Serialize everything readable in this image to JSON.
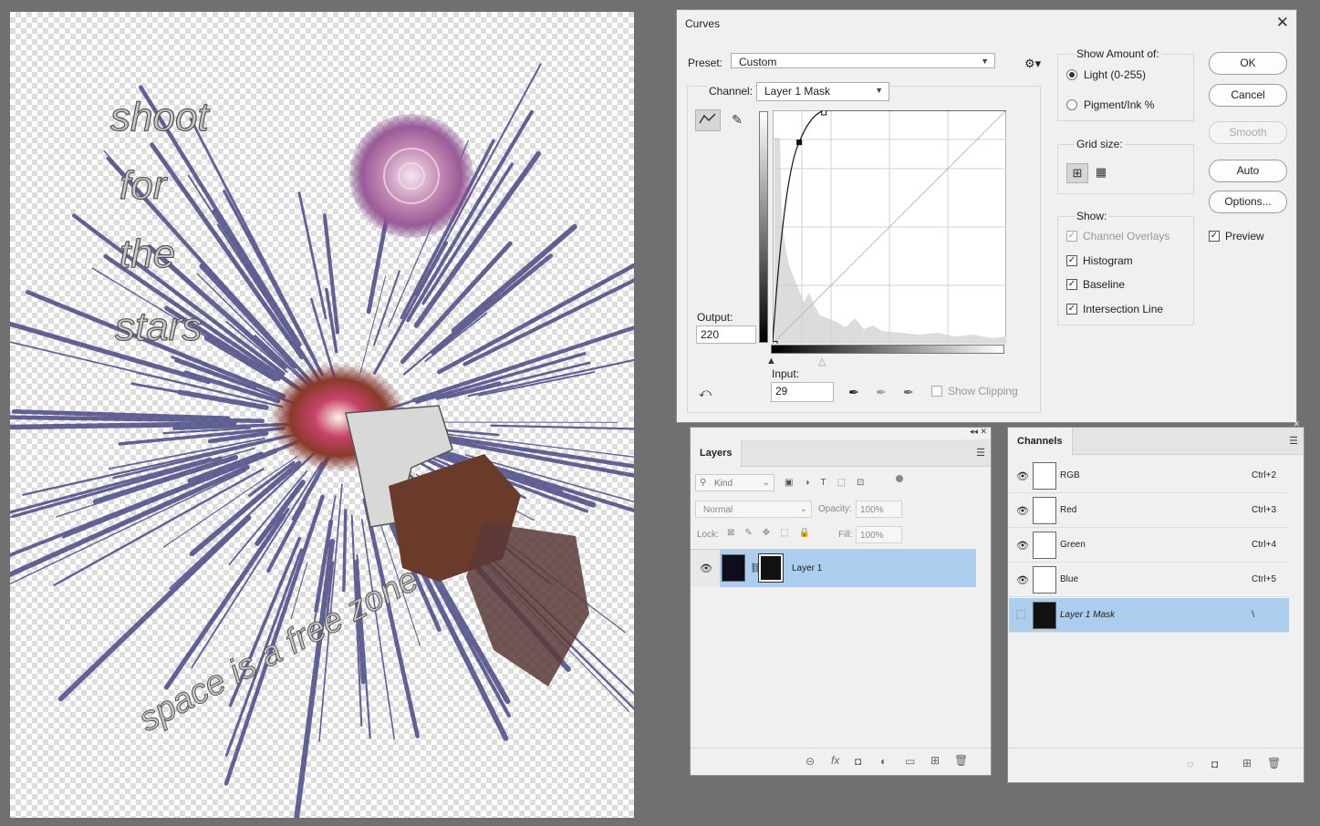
{
  "artwork": {
    "lines": [
      "shoot",
      "for",
      "the",
      "stars"
    ],
    "bottom_text": "space is a free zone"
  },
  "curves": {
    "title": "Curves",
    "preset_label": "Preset:",
    "preset_value": "Custom",
    "channel_label": "Channel:",
    "channel_value": "Layer 1 Mask",
    "output_label": "Output:",
    "output_value": "220",
    "input_label": "Input:",
    "input_value": "29",
    "show_clipping": "Show Clipping",
    "show_amount_title": "Show Amount of:",
    "light_label": "Light  (0-255)",
    "pigment_label": "Pigment/Ink %",
    "grid_size_title": "Grid size:",
    "show_title": "Show:",
    "show_options": [
      "Channel Overlays",
      "Histogram",
      "Baseline",
      "Intersection Line"
    ],
    "buttons": {
      "ok": "OK",
      "cancel": "Cancel",
      "smooth": "Smooth",
      "auto": "Auto",
      "options": "Options..."
    },
    "preview_label": "Preview",
    "curve_points": [
      [
        0,
        0
      ],
      [
        29,
        220
      ],
      [
        56,
        255
      ]
    ]
  },
  "layers": {
    "tab": "Layers",
    "kind": "Kind",
    "blend_mode": "Normal",
    "opacity_label": "Opacity:",
    "opacity_value": "100%",
    "lock_label": "Lock:",
    "fill_label": "Fill:",
    "fill_value": "100%",
    "items": [
      {
        "name": "Layer 1"
      }
    ]
  },
  "channels": {
    "tab": "Channels",
    "items": [
      {
        "name": "RGB",
        "shortcut": "Ctrl+2"
      },
      {
        "name": "Red",
        "shortcut": "Ctrl+3"
      },
      {
        "name": "Green",
        "shortcut": "Ctrl+4"
      },
      {
        "name": "Blue",
        "shortcut": "Ctrl+5"
      },
      {
        "name": "Layer 1 Mask",
        "shortcut": "\\"
      }
    ]
  }
}
